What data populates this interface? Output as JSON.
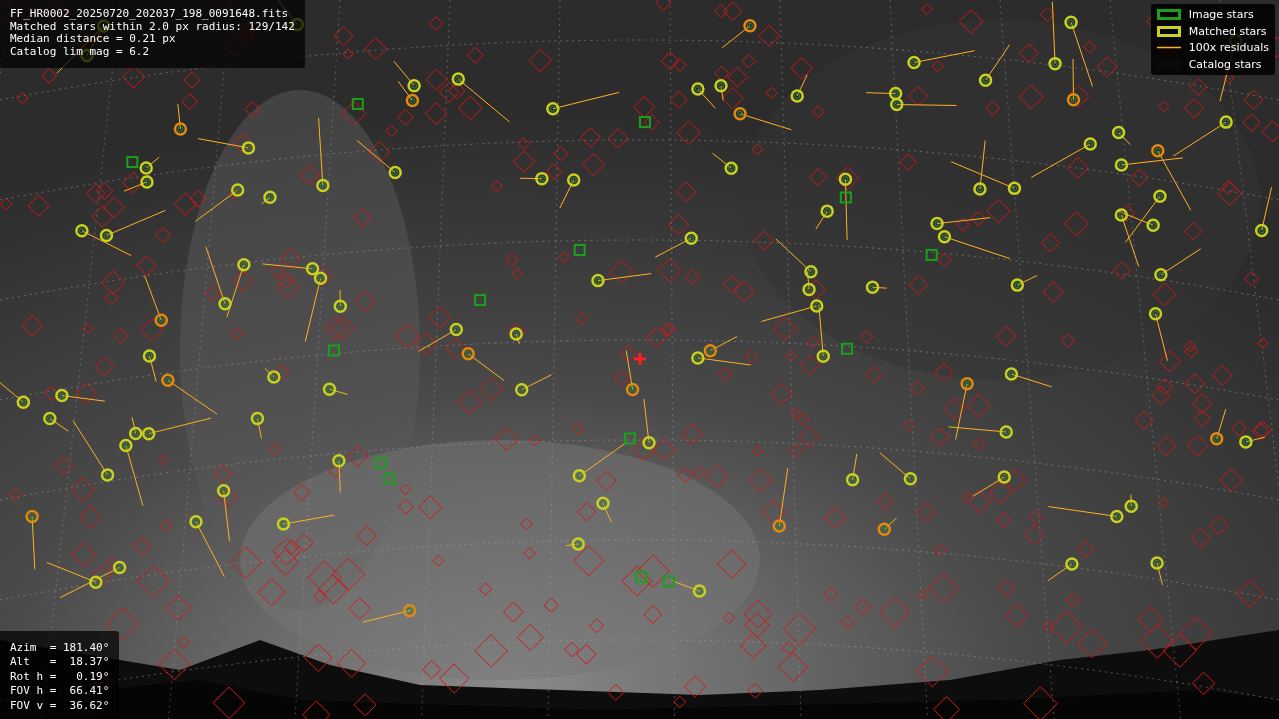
{
  "info_box": {
    "lines": [
      "FF_HR0002_20250720_202037_198_0091648.fits",
      "Matched stars within 2.0 px radius: 129/142",
      "Median distance = 0.21 px",
      "Catalog lim mag = 6.2"
    ]
  },
  "pointing_box": {
    "lines": [
      "Azim  = 181.40°",
      "Alt   =  18.37°",
      "Rot h =   0.19°",
      "FOV h =  66.41°",
      "FOV v =  36.62°"
    ]
  },
  "legend": {
    "items": [
      {
        "label": "Image stars"
      },
      {
        "kind": "matched",
        "label": "Matched stars"
      },
      {
        "kind": "residual",
        "label": "100x residuals"
      },
      {
        "kind": "catalog",
        "label": "Catalog stars"
      }
    ]
  }
}
